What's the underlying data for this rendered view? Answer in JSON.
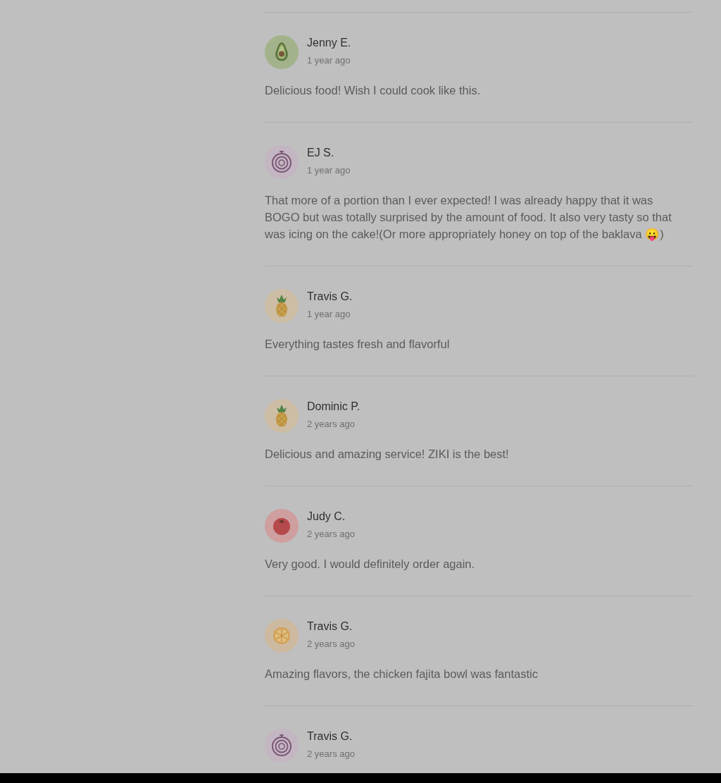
{
  "reviews": [
    {
      "kind": "avocado",
      "name": "Jenny E.",
      "time": "1 year ago",
      "text": "Delicious food! Wish I could cook like this."
    },
    {
      "kind": "onion",
      "name": "EJ S.",
      "time": "1 year ago",
      "text": "That more of a portion than I ever expected! I was already happy that it was BOGO but was totally surprised by the amount of food. It also very tasty so that was icing on the cake!(Or more appropriately honey on top of the baklava 😛)"
    },
    {
      "kind": "pineapple",
      "name": "Travis G.",
      "time": "1 year ago",
      "text": "Everything tastes fresh and flavorful"
    },
    {
      "kind": "pineapple",
      "name": "Dominic P.",
      "time": "2 years ago",
      "text": "Delicious and amazing service! ZIKI is the best!"
    },
    {
      "kind": "tomato",
      "name": "Judy C.",
      "time": "2 years ago",
      "text": "Very good. I would definitely order again."
    },
    {
      "kind": "citrus",
      "name": "Travis G.",
      "time": "2 years ago",
      "text": "Amazing flavors, the chicken fajita bowl was fantastic"
    },
    {
      "kind": "onion",
      "name": "Travis G.",
      "time": "2 years ago"
    }
  ]
}
